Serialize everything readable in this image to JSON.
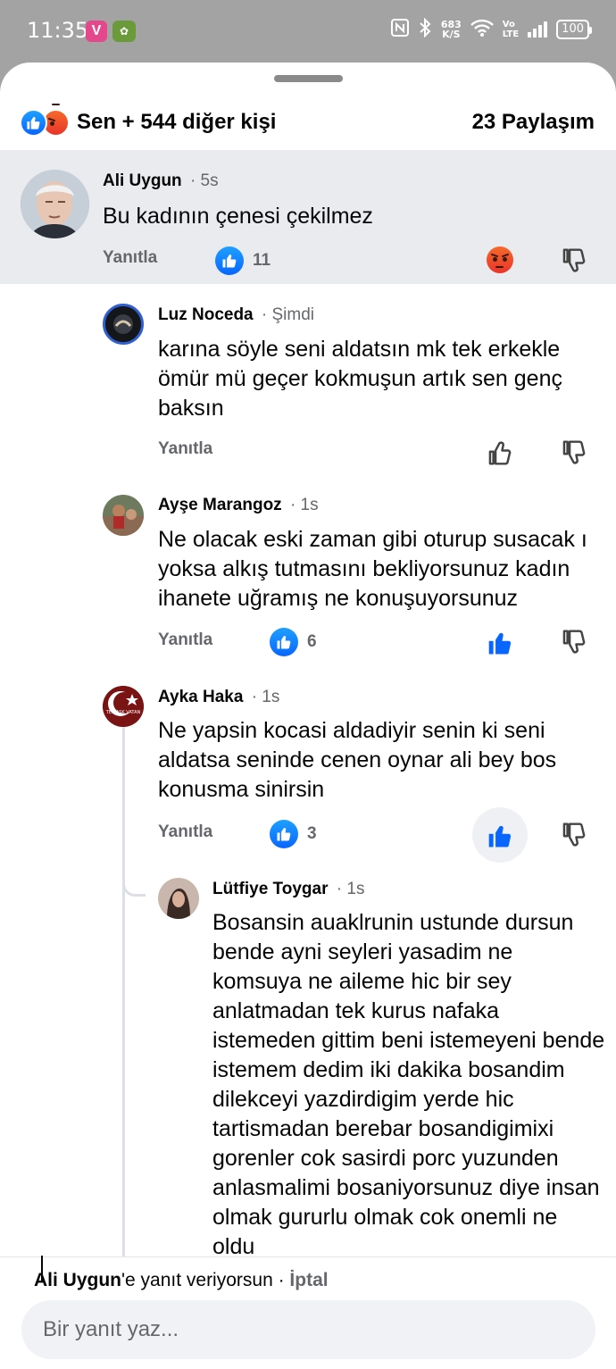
{
  "status_bar": {
    "time": "11:35",
    "net_speed": "683",
    "net_unit": "K/S",
    "volte_top": "Vo",
    "volte_bottom": "LTE",
    "battery": "100"
  },
  "reactions": {
    "summary": "Sen + 544 diğer kişi",
    "shares": "23 Paylaşım"
  },
  "comments": [
    {
      "author": "Ali Uygun",
      "time": "· 5s",
      "text": "Bu kadının çenesi çekilmez",
      "reply_label": "Yanıtla",
      "like_count": "11"
    },
    {
      "author": "Luz Noceda",
      "time": "· Şimdi",
      "text": "karına söyle seni aldatsın mk tek erkekle ömür mü geçer kokmuşun artık sen genç baksın",
      "reply_label": "Yanıtla"
    },
    {
      "author": "Ayşe Marangoz",
      "time": "· 1s",
      "text": "Ne olacak eski zaman gibi oturup susacak ı yoksa alkış tutmasını bekliyorsunuz kadın ihanete uğramış ne konuşuyorsunuz",
      "reply_label": "Yanıtla",
      "like_count": "6"
    },
    {
      "author": "Ayka Haka",
      "time": "· 1s",
      "text": "Ne yapsin kocasi aldadiyir senin ki seni aldatsa seninde cenen oynar ali bey bos konusma sinirsin",
      "reply_label": "Yanıtla",
      "like_count": "3"
    },
    {
      "author": "Lütfiye Toygar",
      "time": "· 1s",
      "text": "Bosansin auaklrunin ustunde dursun bende ayni seyleri yasadim ne komsuya ne aileme hic bir sey anlatmadan tek kurus nafaka istemeden gittim beni istemeyeni bende istemem dedim iki dakika bosandim  dilekceyi yazdirdigim yerde hic tartismadan berebar bosandigimixi gorenler cok sasirdi porc yuzunden anlasmalimi bosaniyorsunuz diye insan olmak gururlu olmak cok onemli ne oldu"
    }
  ],
  "composer": {
    "replying_name": "Ali Uygun",
    "replying_suffix": "'e yanıt veriyorsun · ",
    "cancel": "İptal",
    "placeholder": "Bir yanıt yaz..."
  },
  "avatar_badge_ayka": "TEK AŞK VATAN",
  "colors": {
    "fb_blue": "#0866ff",
    "angry": "#e9342a",
    "highlight": "#e9ebef",
    "secondary_text": "#65676b"
  }
}
